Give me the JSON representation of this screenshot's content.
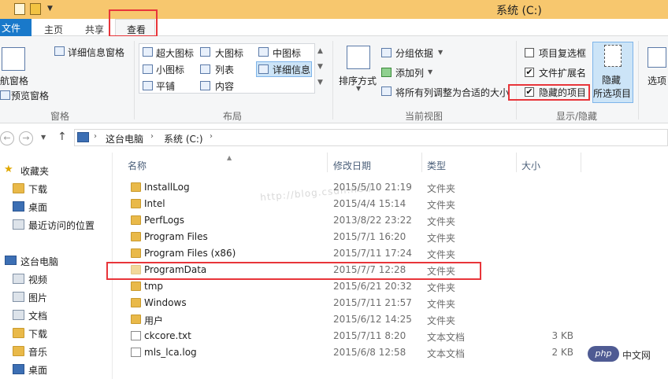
{
  "window": {
    "title": "系统 (C:)"
  },
  "ribbon_tabs": {
    "file": "文件",
    "home": "主页",
    "share": "共享",
    "view": "查看"
  },
  "ribbon": {
    "pane_group": {
      "label": "窗格",
      "nav_pane": "导航窗格",
      "nav_pane_visible": "航窗格",
      "preview_pane": "预览窗格",
      "details_pane": "详细信息窗格"
    },
    "layout_group": {
      "label": "布局",
      "extra_large": "超大图标",
      "large": "大图标",
      "medium": "中图标",
      "small": "小图标",
      "list": "列表",
      "details": "详细信息",
      "tiles": "平铺",
      "content": "内容"
    },
    "view_group": {
      "label": "当前视图",
      "sort_by": "排序方式",
      "group_by": "分组依据",
      "add_columns": "添加列",
      "fit_columns": "将所有列调整为合适的大小"
    },
    "showhide_group": {
      "label": "显示/隐藏",
      "item_checkbox": "项目复选框",
      "file_ext": "文件扩展名",
      "hidden_items": "隐藏的项目",
      "hide_selected_1": "隐藏",
      "hide_selected_2": "所选项目",
      "options": "选项",
      "check_mark": "✔"
    }
  },
  "address": {
    "crumbs": [
      "这台电脑",
      "系统 (C:)"
    ]
  },
  "nav": {
    "favorites": "收藏夹",
    "fav_items": [
      "下载",
      "桌面",
      "最近访问的位置"
    ],
    "computer": "这台电脑",
    "pc_items": [
      "视频",
      "图片",
      "文档",
      "下载",
      "音乐",
      "桌面"
    ]
  },
  "columns": {
    "name": "名称",
    "date": "修改日期",
    "type": "类型",
    "size": "大小"
  },
  "files": [
    {
      "name": "InstallLog",
      "date": "2015/5/10 21:19",
      "type": "文件夹",
      "size": ""
    },
    {
      "name": "Intel",
      "date": "2015/4/4 15:14",
      "type": "文件夹",
      "size": ""
    },
    {
      "name": "PerfLogs",
      "date": "2013/8/22 23:22",
      "type": "文件夹",
      "size": ""
    },
    {
      "name": "Program Files",
      "date": "2015/7/1 16:20",
      "type": "文件夹",
      "size": ""
    },
    {
      "name": "Program Files (x86)",
      "date": "2015/7/11 17:24",
      "type": "文件夹",
      "size": ""
    },
    {
      "name": "ProgramData",
      "date": "2015/7/7 12:28",
      "type": "文件夹",
      "size": ""
    },
    {
      "name": "tmp",
      "date": "2015/6/21 20:32",
      "type": "文件夹",
      "size": ""
    },
    {
      "name": "Windows",
      "date": "2015/7/11 21:57",
      "type": "文件夹",
      "size": ""
    },
    {
      "name": "用户",
      "date": "2015/6/12 14:25",
      "type": "文件夹",
      "size": ""
    },
    {
      "name": "ckcore.txt",
      "date": "2015/7/11 8:20",
      "type": "文本文档",
      "size": "3 KB"
    },
    {
      "name": "mls_lca.log",
      "date": "2015/6/8 12:58",
      "type": "文本文档",
      "size": "2 KB"
    }
  ],
  "overlay": {
    "watermark": "http://blog.csdn.net/",
    "logo": "php中文网"
  }
}
